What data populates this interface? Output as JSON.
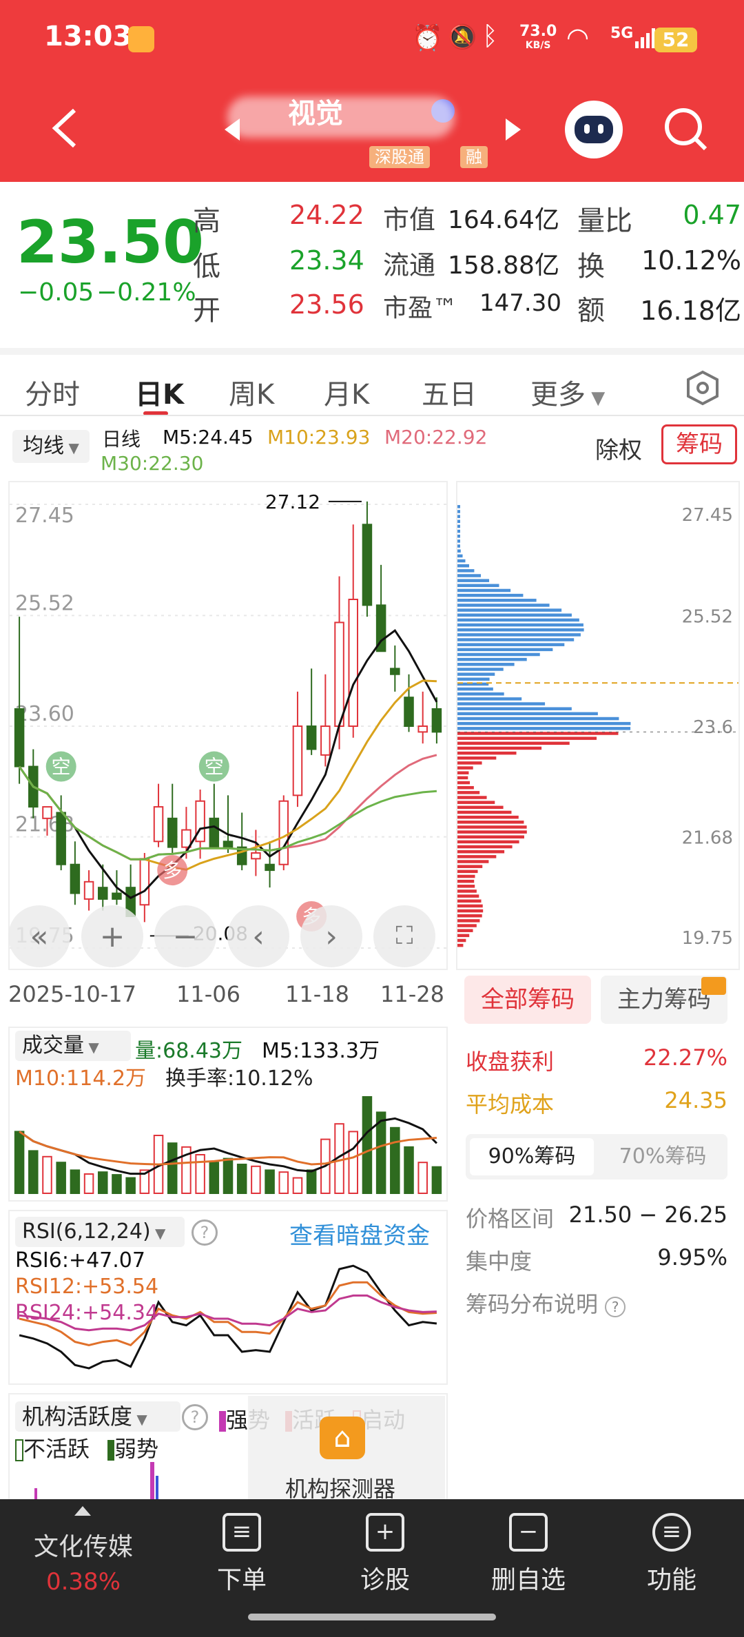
{
  "status": {
    "time": "13:03",
    "speed": "73.0",
    "speed_unit": "KB/S",
    "network": "5G",
    "battery": "52"
  },
  "header": {
    "stock_name": "视觉",
    "tag_hsgt": "深股通",
    "tag_margin": "融"
  },
  "quote": {
    "price": "23.50",
    "change": "−0.05",
    "change_pct": "−0.21%",
    "high_label": "高",
    "high": "24.22",
    "low_label": "低",
    "low": "23.34",
    "open_label": "开",
    "open": "23.56",
    "mktcap_label": "市值",
    "mktcap": "164.64亿",
    "float_label": "流通",
    "float": "158.88亿",
    "pe_label": "市盈™",
    "pe": "147.30",
    "volratio_label": "量比",
    "volratio": "0.47",
    "turnover_label": "换",
    "turnover": "10.12%",
    "amount_label": "额",
    "amount": "16.18亿"
  },
  "tabs": [
    "分时",
    "日K",
    "周K",
    "月K",
    "五日",
    "更多"
  ],
  "active_tab": "日K",
  "ma_legend": {
    "dropdown": "均线",
    "period": "日线",
    "m5": "M5:24.45",
    "m10": "M10:23.93",
    "m20": "M20:22.92",
    "m30": "M30:22.30",
    "exright": "除权",
    "chips_btn": "筹码"
  },
  "kline": {
    "price_ticks": [
      "27.45",
      "25.52",
      "23.60",
      "21.68",
      "19.75"
    ],
    "max_label": "27.12",
    "min_label": "20.08",
    "dates": [
      "2025-10-17",
      "11-06",
      "11-18",
      "11-28"
    ],
    "markers": {
      "kong": "空",
      "duo": "多"
    }
  },
  "volume": {
    "dropdown": "成交量",
    "vol": "量:68.43万",
    "m5": "M5:133.3万",
    "m10": "M10:114.2万",
    "turnover": "换手率:10.12%"
  },
  "rsi": {
    "dropdown": "RSI(6,12,24)",
    "link": "查看暗盘资金",
    "rsi6": "RSI6:+47.07",
    "rsi12": "RSI12:+53.54",
    "rsi24": "RSI24:+54.34"
  },
  "inst": {
    "dropdown": "机构活跃度",
    "strong": "强势",
    "active": "活跃",
    "start": "启动",
    "inactive": "不活跃",
    "weak": "弱势",
    "detector": "机构探测器"
  },
  "chips": {
    "ticks": [
      "27.45",
      "25.52",
      "23.6",
      "21.68",
      "19.75"
    ],
    "tab_all": "全部筹码",
    "tab_main": "主力筹码",
    "profit_label": "收盘获利",
    "profit": "22.27%",
    "avg_label": "平均成本",
    "avg": "24.35",
    "sub90": "90%筹码",
    "sub70": "70%筹码",
    "range_label": "价格区间",
    "range": "21.50 − 26.25",
    "conc_label": "集中度",
    "conc": "9.95%",
    "explain": "筹码分布说明"
  },
  "bottom": {
    "sector": "文化传媒",
    "sector_pct": "0.38%",
    "order": "下单",
    "diagnose": "诊股",
    "remove": "删自选",
    "functions": "功能"
  },
  "colors": {
    "up": "#e0333a",
    "down": "#2e6b1f",
    "brand": "#ee3b3d",
    "ma5": "#111111",
    "ma10": "#d9a21b",
    "ma20": "#e06a7a",
    "ma30": "#6cb34a",
    "chip_blue": "#4a90d9",
    "chip_red": "#e0333a"
  },
  "chart_data": {
    "type": "candlestick",
    "x": [
      "10-17",
      "10-20",
      "10-21",
      "10-22",
      "10-23",
      "10-24",
      "10-27",
      "10-28",
      "10-29",
      "10-30",
      "10-31",
      "11-03",
      "11-04",
      "11-05",
      "11-06",
      "11-07",
      "11-10",
      "11-11",
      "11-12",
      "11-13",
      "11-14",
      "11-17",
      "11-18",
      "11-19",
      "11-20",
      "11-21",
      "11-24",
      "11-25",
      "11-26",
      "11-27",
      "11-28"
    ],
    "open": [
      23.9,
      22.9,
      22.0,
      22.1,
      21.2,
      20.6,
      20.8,
      20.7,
      20.8,
      20.5,
      21.6,
      22.0,
      21.5,
      21.6,
      22.0,
      21.6,
      21.5,
      21.3,
      21.2,
      21.2,
      22.4,
      23.6,
      23.1,
      23.6,
      23.6,
      27.1,
      25.7,
      24.6,
      24.1,
      23.5,
      23.9
    ],
    "high": [
      25.5,
      23.2,
      22.2,
      22.4,
      21.6,
      21.1,
      21.2,
      21.1,
      21.2,
      21.4,
      22.6,
      22.6,
      22.2,
      22.5,
      22.6,
      22.4,
      22.1,
      21.8,
      21.6,
      22.4,
      24.2,
      24.6,
      24.5,
      26.2,
      27.1,
      27.5,
      26.4,
      25.0,
      24.5,
      24.2,
      24.1
    ],
    "low": [
      22.6,
      22.0,
      21.7,
      21.1,
      20.5,
      20.4,
      20.4,
      20.5,
      20.4,
      20.2,
      21.5,
      21.4,
      21.3,
      21.3,
      21.5,
      21.4,
      21.1,
      21.0,
      20.8,
      21.1,
      22.2,
      23.1,
      22.9,
      23.2,
      23.4,
      25.5,
      25.2,
      24.2,
      23.5,
      23.3,
      23.3
    ],
    "close": [
      22.9,
      22.2,
      22.2,
      21.2,
      20.7,
      20.9,
      20.6,
      20.6,
      20.3,
      21.3,
      22.2,
      21.5,
      21.8,
      22.3,
      21.5,
      21.5,
      21.2,
      21.4,
      21.1,
      22.3,
      23.6,
      23.2,
      23.6,
      25.4,
      25.8,
      25.7,
      24.9,
      24.5,
      23.6,
      23.6,
      23.5
    ],
    "volume": [
      160,
      110,
      95,
      80,
      60,
      50,
      55,
      48,
      40,
      60,
      150,
      130,
      120,
      100,
      80,
      90,
      75,
      70,
      60,
      55,
      40,
      60,
      140,
      180,
      160,
      250,
      210,
      170,
      120,
      80,
      68.43
    ],
    "ylim": [
      19.75,
      27.45
    ],
    "rsi6": [
      40,
      38,
      35,
      30,
      22,
      20,
      24,
      25,
      21,
      38,
      60,
      48,
      46,
      52,
      40,
      40,
      30,
      31,
      30,
      48,
      66,
      55,
      58,
      80,
      82,
      78,
      66,
      55,
      46,
      48,
      47.07
    ],
    "rsi12": [
      50,
      48,
      46,
      42,
      36,
      34,
      36,
      37,
      34,
      42,
      56,
      52,
      50,
      54,
      48,
      48,
      42,
      42,
      41,
      50,
      60,
      56,
      58,
      70,
      72,
      72,
      64,
      58,
      54,
      53,
      53.54
    ],
    "rsi24": [
      52,
      51,
      50,
      48,
      44,
      43,
      44,
      44,
      43,
      46,
      53,
      51,
      51,
      53,
      50,
      50,
      47,
      47,
      46,
      50,
      56,
      54,
      55,
      62,
      64,
      64,
      60,
      57,
      55,
      54,
      54.34
    ]
  }
}
